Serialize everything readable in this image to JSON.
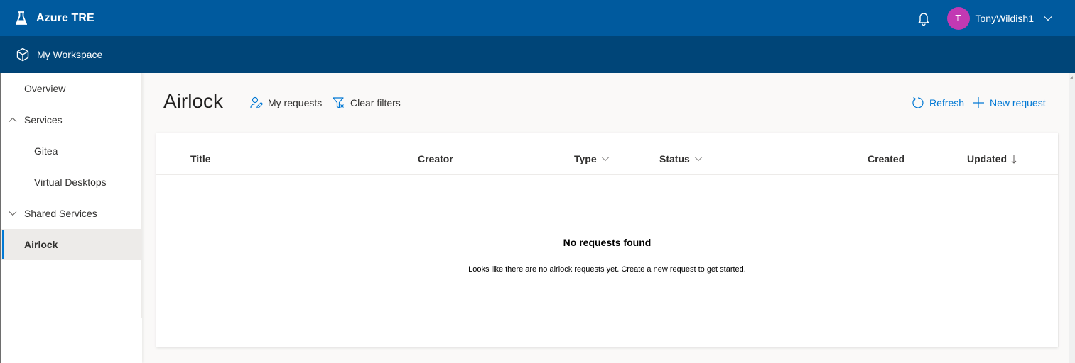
{
  "header": {
    "app_title": "Azure TRE",
    "brand_icon": "flask-icon",
    "notifications_icon": "bell-icon",
    "user": {
      "initial": "T",
      "name": "TonyWildish1",
      "avatar_color": "#c239b3",
      "menu_icon": "chevron-down-icon"
    }
  },
  "workspace_bar": {
    "icon": "cube-icon",
    "title": "My Workspace"
  },
  "sidebar": {
    "items": [
      {
        "label": "Overview",
        "level": 0
      },
      {
        "label": "Services",
        "level": 0,
        "expanded": true,
        "icon": "chevron-up-icon"
      },
      {
        "label": "Gitea",
        "level": 1
      },
      {
        "label": "Virtual Desktops",
        "level": 1
      },
      {
        "label": "Shared Services",
        "level": 0,
        "expanded": false,
        "icon": "chevron-down-icon"
      },
      {
        "label": "Airlock",
        "level": 0,
        "active": true
      }
    ]
  },
  "main": {
    "page_title": "Airlock",
    "commands": {
      "my_requests": "My requests",
      "clear_filters": "Clear filters",
      "refresh": "Refresh",
      "new_request": "New request"
    },
    "table": {
      "columns": [
        {
          "label": "Title"
        },
        {
          "label": "Creator"
        },
        {
          "label": "Type",
          "filter": true
        },
        {
          "label": "Status",
          "filter": true
        },
        {
          "label": "Created"
        },
        {
          "label": "Updated",
          "sort": "descending"
        }
      ],
      "rows": []
    },
    "empty_state": {
      "title": "No requests found",
      "message": "Looks like there are no airlock requests yet. Create a new request to get started."
    }
  },
  "colors": {
    "header_bg": "#005a9e",
    "workspace_bar_bg": "#004578",
    "accent": "#0078d4",
    "page_bg": "#faf9f8"
  }
}
